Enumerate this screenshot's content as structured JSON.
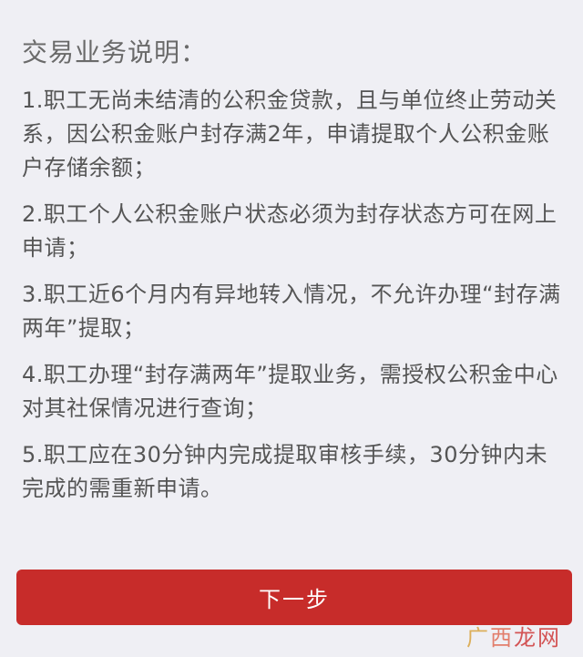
{
  "section": {
    "title": "交易业务说明：",
    "items": [
      "1.职工无尚未结清的公积金贷款，且与单位终止劳动关系，因公积金账户封存满2年，申请提取个人公积金账户存储余额；",
      "2.职工个人公积金账户状态必须为封存状态方可在网上申请；",
      "3.职工近6个月内有异地转入情况，不允许办理“封存满两年”提取；",
      "4.职工办理“封存满两年”提取业务，需授权公积金中心对其社保情况进行查询；",
      "5.职工应在30分钟内完成提取审核手续，30分钟内未完成的需重新申请。"
    ]
  },
  "next_button": {
    "label": "下一步"
  },
  "watermark": {
    "chars": [
      "广",
      "西",
      "龙",
      "网"
    ]
  },
  "colors": {
    "background": "#efeff4",
    "text": "#555555",
    "button": "#c72c2a",
    "button_text": "#ffffff"
  }
}
